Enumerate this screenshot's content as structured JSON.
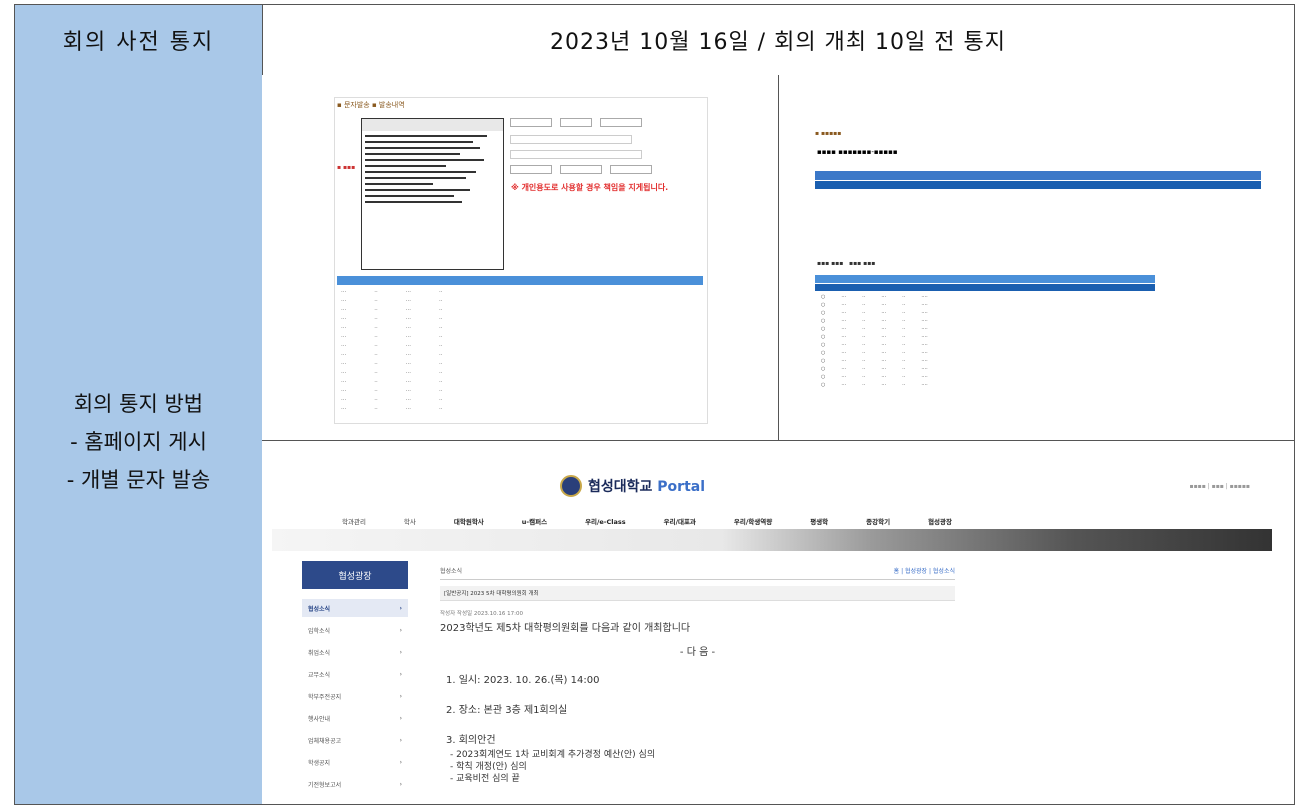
{
  "header": {
    "label": "회의 사전 통지",
    "value": "2023년 10월 16일 / 회의 개최 10일 전 통지"
  },
  "side": {
    "line1": "회의 통지 방법",
    "line2": "- 홈페이지 게시",
    "line3": "- 개별 문자 발송"
  },
  "screen1": {
    "warning": "※ 개인용도로 사용할 경우 책임을 지게됩니다."
  },
  "portal": {
    "brand": "협성대학교",
    "brand_suffix": "Portal",
    "nav": [
      "학과관리",
      "학사",
      "대학원학사",
      "u-캠퍼스",
      "우리/e-Class",
      "우리/대포과",
      "우리/학생역량",
      "평생학",
      "종강학기",
      "협성광장"
    ],
    "sidebar_title": "협성광장",
    "sidebar_items": [
      "협성소식",
      "입학소식",
      "취업소식",
      "교무소식",
      "학부주전공지",
      "행사안내",
      "업체채용공고",
      "학생공지",
      "기전형보고서"
    ],
    "breadcrumb": "협성소식",
    "actions": "홈 | 협성광장 | 협성소식",
    "subject": "[일반공지] 2023 5차 대학평의원회 개최",
    "meta": "작성자                 작성일  2023.10.16 17:00",
    "intro": "2023학년도 제5차 대학평의원회를 다음과 같이 개최합니다",
    "center": "- 다          음 -",
    "item1": "1. 일시: 2023. 10. 26.(목) 14:00",
    "item2": "2. 장소: 본관 3층 제1회의실",
    "item3": "3. 회의안건",
    "item3a": "- 2023회계연도 1차 교비회계 추가경정 예산(안) 심의",
    "item3b": "- 학칙 개정(안) 심의",
    "item3c": "- 교육비전 심의  끝"
  }
}
